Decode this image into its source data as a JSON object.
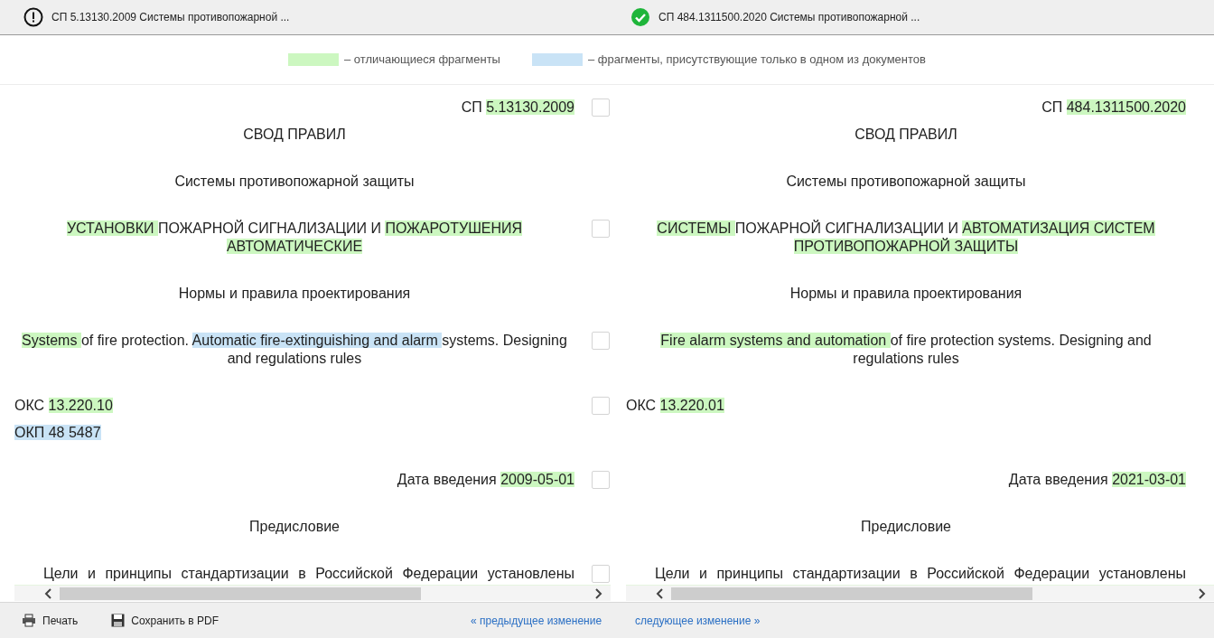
{
  "documents": [
    {
      "kind": "warning",
      "title": "СП 5.13130.2009 Системы противопожарной ..."
    },
    {
      "kind": "ok",
      "title": "СП 484.1311500.2020 Системы противопожарной ..."
    }
  ],
  "legend": [
    {
      "kind": "diff",
      "label": "– отличающиеся фрагменты"
    },
    {
      "kind": "only",
      "label": "– фрагменты, присутствующие только в одном из документов"
    }
  ],
  "rows": [
    {
      "kind": "right",
      "checked": false,
      "left": [
        [
          {
            "kind": "plain",
            "text": "СП "
          },
          {
            "kind": "diff",
            "text": "5.13130.2009"
          }
        ]
      ],
      "right": [
        [
          {
            "kind": "plain",
            "text": "СП "
          },
          {
            "kind": "diff",
            "text": "484.1311500.2020"
          }
        ]
      ]
    },
    {
      "kind": "center",
      "left": [
        [
          {
            "kind": "plain",
            "text": "СВОД ПРАВИЛ"
          }
        ]
      ],
      "right": [
        [
          {
            "kind": "plain",
            "text": "СВОД ПРАВИЛ"
          }
        ]
      ]
    },
    {
      "kind": "center",
      "left": [
        [
          {
            "kind": "plain",
            "text": "Системы противопожарной защиты"
          }
        ]
      ],
      "right": [
        [
          {
            "kind": "plain",
            "text": "Системы противопожарной защиты"
          }
        ]
      ]
    },
    {
      "kind": "center",
      "checked": false,
      "left": [
        [
          {
            "kind": "diff",
            "text": "УСТАНОВКИ "
          },
          {
            "kind": "plain",
            "text": "ПОЖАРНОЙ СИГНАЛИЗАЦИИ И "
          },
          {
            "kind": "diff",
            "text": "ПОЖАРОТУШЕНИЯ АВТОМАТИЧЕСКИЕ"
          }
        ]
      ],
      "right": [
        [
          {
            "kind": "diff",
            "text": "СИСТЕМЫ "
          },
          {
            "kind": "plain",
            "text": "ПОЖАРНОЙ СИГНАЛИЗАЦИИ И "
          },
          {
            "kind": "diff",
            "text": "АВТОМАТИЗАЦИЯ СИСТЕМ ПРОТИВОПОЖАРНОЙ ЗАЩИТЫ"
          }
        ]
      ]
    },
    {
      "kind": "center",
      "left": [
        [
          {
            "kind": "plain",
            "text": "Нормы и правила проектирования"
          }
        ]
      ],
      "right": [
        [
          {
            "kind": "plain",
            "text": "Нормы и правила проектирования"
          }
        ]
      ]
    },
    {
      "kind": "center",
      "checked": false,
      "left": [
        [
          {
            "kind": "diff",
            "text": "Systems "
          },
          {
            "kind": "plain",
            "text": "of fire protection. "
          },
          {
            "kind": "only",
            "text": "Automatic fire-extinguishing and alarm "
          },
          {
            "kind": "plain",
            "text": "systems. Designing and regulations rules"
          }
        ]
      ],
      "right": [
        [
          {
            "kind": "diff",
            "text": "Fire alarm systems and automation "
          },
          {
            "kind": "plain",
            "text": "of fire protection systems. Designing and regulations rules"
          }
        ]
      ]
    },
    {
      "kind": "left",
      "checked": false,
      "left": [
        [
          {
            "kind": "plain",
            "text": "ОКС "
          },
          {
            "kind": "diff",
            "text": "13.220.10"
          }
        ],
        [
          {
            "kind": "only",
            "text": "ОКП 48 5487"
          }
        ]
      ],
      "right": [
        [
          {
            "kind": "plain",
            "text": "ОКС "
          },
          {
            "kind": "diff",
            "text": "13.220.01"
          }
        ]
      ]
    },
    {
      "kind": "right",
      "checked": false,
      "left": [
        [
          {
            "kind": "plain",
            "text": "Дата введения "
          },
          {
            "kind": "diff",
            "text": "2009-05-01"
          }
        ]
      ],
      "right": [
        [
          {
            "kind": "plain",
            "text": "Дата введения "
          },
          {
            "kind": "diff",
            "text": "2021-03-01"
          }
        ]
      ]
    },
    {
      "kind": "center",
      "left": [
        [
          {
            "kind": "plain",
            "text": "Предисловие"
          }
        ]
      ],
      "right": [
        [
          {
            "kind": "plain",
            "text": "Предисловие"
          }
        ]
      ]
    },
    {
      "kind": "justify",
      "checked": false,
      "left": [
        [
          {
            "kind": "plain",
            "text": "Цели и принципы стандартизации в Российской Федерации установлены"
          }
        ]
      ],
      "right": [
        [
          {
            "kind": "plain",
            "text": "Цели и принципы стандартизации в Российской Федерации установлены"
          }
        ]
      ]
    }
  ],
  "footer": {
    "print": "Печать",
    "save_pdf": "Сохранить в PDF",
    "prev": "« предыдущее изменение",
    "next": "следующее изменение »"
  }
}
